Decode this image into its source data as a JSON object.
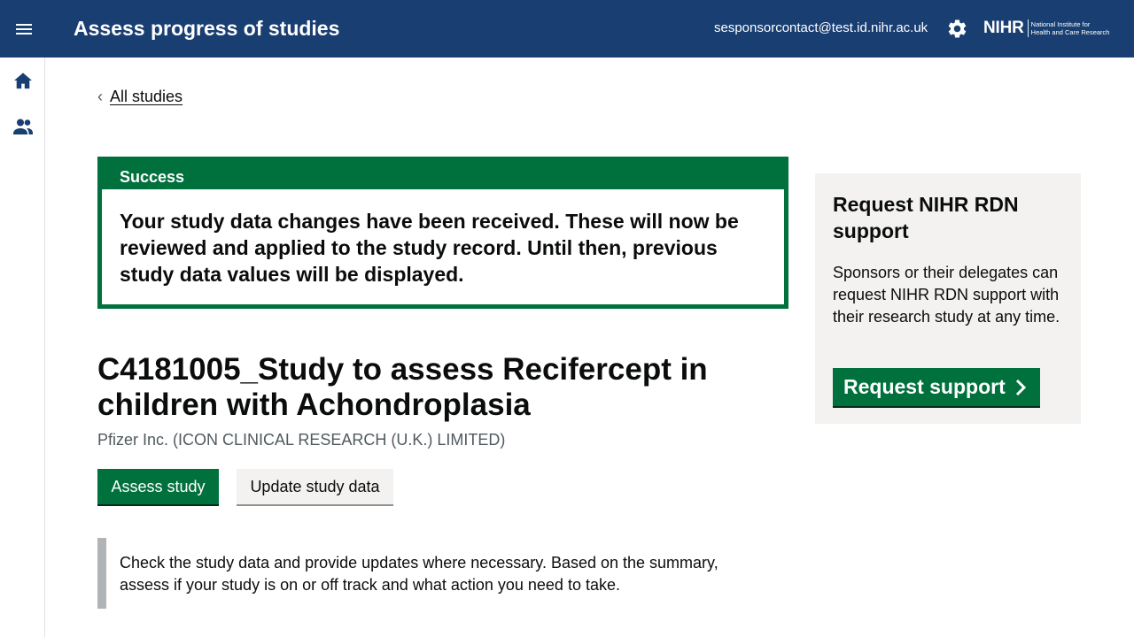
{
  "header": {
    "menu_icon": "hamburger-menu-icon",
    "title": "Assess progress of studies",
    "user_email": "sesponsorcontact@test.id.nihr.ac.uk",
    "settings_icon": "gear-icon",
    "logo": {
      "mark": "NIHR",
      "line1": "National Institute for",
      "line2": "Health and Care Research"
    }
  },
  "sidebar": {
    "items": [
      {
        "icon": "home-icon"
      },
      {
        "icon": "users-icon"
      }
    ]
  },
  "breadcrumb": {
    "back_label": "All studies"
  },
  "notification": {
    "title": "Success",
    "message": "Your study data changes have been received. These will now be reviewed and applied to the study record. Until then, previous study data values will be displayed."
  },
  "study": {
    "title": "C4181005_Study to assess Recifercept in children with Achondroplasia",
    "organisation": "Pfizer Inc. (ICON CLINICAL RESEARCH (U.K.) LIMITED)"
  },
  "actions": {
    "assess_label": "Assess study",
    "update_label": "Update study data"
  },
  "guidance": {
    "text": "Check the study data and provide updates where necessary. Based on the summary, assess if your study is on or off track and what action you need to take."
  },
  "support_panel": {
    "title": "Request NIHR RDN support",
    "text": "Sponsors or their delegates can request NIHR RDN support with their research study at any time.",
    "button_label": "Request support"
  },
  "colors": {
    "header_bg": "#193e72",
    "success_green": "#00703c",
    "panel_bg": "#f3f2f1",
    "inset_border": "#b1b4b6"
  }
}
